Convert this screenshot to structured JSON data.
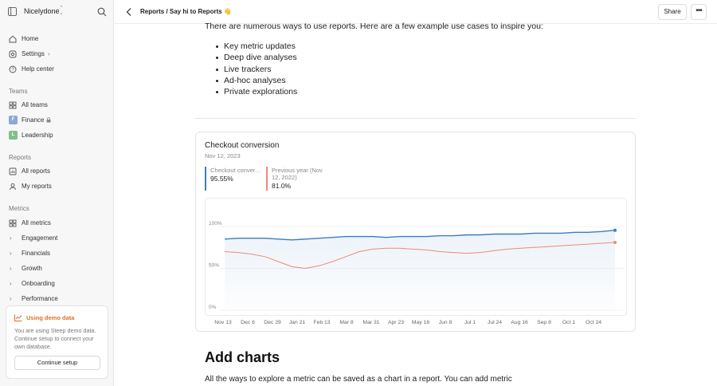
{
  "workspace": {
    "name": "Nicelydone"
  },
  "nav": {
    "top": [
      {
        "label": "Home",
        "icon": "home-icon"
      },
      {
        "label": "Settings",
        "icon": "gear-icon"
      },
      {
        "label": "Help center",
        "icon": "help-icon"
      }
    ],
    "teams_header": "Teams",
    "teams": [
      {
        "label": "All teams"
      },
      {
        "label": "Finance",
        "badge": "F",
        "badge_color": "#8aa8d8"
      },
      {
        "label": "Leadership",
        "badge": "L",
        "badge_color": "#7fbf8a"
      }
    ],
    "reports_header": "Reports",
    "reports": [
      {
        "label": "All reports"
      },
      {
        "label": "My reports"
      }
    ],
    "metrics_header": "Metrics",
    "metrics": [
      {
        "label": "All metrics"
      },
      {
        "label": "Engagement"
      },
      {
        "label": "Financials"
      },
      {
        "label": "Growth"
      },
      {
        "label": "Onboarding"
      },
      {
        "label": "Performance"
      }
    ]
  },
  "demo": {
    "title": "Using demo data",
    "description": "You are using Steep demo data. Continue setup to connect your own database.",
    "button": "Continue setup"
  },
  "topbar": {
    "breadcrumb": "Reports / Say hi to Reports 👋",
    "share": "Share"
  },
  "content": {
    "intro": "There are numerous ways to use reports. Here are a few example use cases to inspire you:",
    "bullets": [
      "Key metric updates",
      "Deep dive analyses",
      "Live trackers",
      "Ad-hoc analyses",
      "Private explorations"
    ],
    "heading": "Add charts",
    "paragraph": "All the ways to explore a metric can be saved as a chart in a report. You can add metric"
  },
  "card": {
    "title": "Checkout conversion",
    "date": "Nov 12, 2023",
    "kpis": [
      {
        "label": "Checkout conversion",
        "value": "95.55%",
        "color": "#3c7dc4"
      },
      {
        "label": "Previous year (Nov 12, 2022)",
        "value": "81.0%",
        "color": "#ec8b76"
      }
    ]
  },
  "chart_data": {
    "type": "line",
    "x_labels": [
      "Nov 13",
      "Dec 6",
      "Dec 29",
      "Jan 21",
      "Feb 13",
      "Mar 8",
      "Mar 31",
      "Apr 23",
      "May 16",
      "Jun 8",
      "Jul 1",
      "Jul 24",
      "Aug 16",
      "Sep 8",
      "Oct 1",
      "Oct 24"
    ],
    "y_ticks": [
      "0%",
      "50%",
      "100%"
    ],
    "ylim": [
      0,
      100
    ],
    "series": [
      {
        "name": "Checkout conversion",
        "color": "#3c7dc4",
        "values": [
          85,
          86,
          86,
          86,
          85,
          84,
          85,
          86,
          87,
          88,
          88,
          88,
          87,
          88,
          88,
          88,
          89,
          89,
          90,
          90,
          91,
          91,
          91,
          92,
          92,
          92,
          93,
          93,
          94,
          95.5
        ]
      },
      {
        "name": "Previous year (Nov 12, 2022)",
        "color": "#ec8b76",
        "values": [
          70,
          69,
          67,
          64,
          58,
          52,
          50,
          53,
          58,
          64,
          70,
          73,
          74,
          74,
          73,
          72,
          70,
          69,
          68,
          69,
          71,
          73,
          74,
          75,
          76,
          77,
          78,
          79,
          80,
          81
        ]
      }
    ]
  }
}
